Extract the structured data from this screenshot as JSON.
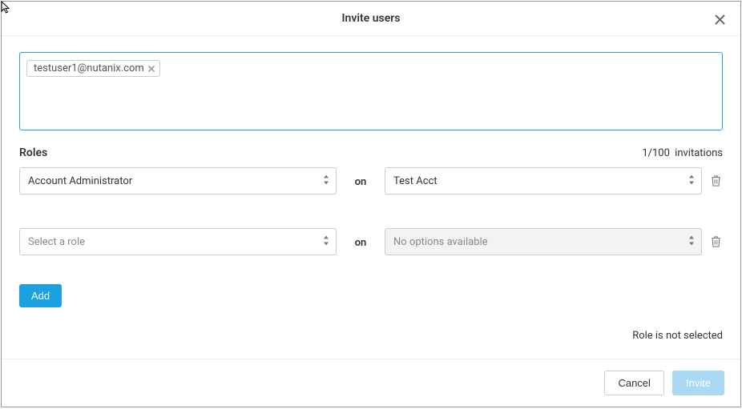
{
  "header": {
    "title": "Invite users"
  },
  "emails": {
    "chips": [
      "testuser1@nutanix.com"
    ]
  },
  "invitations_label_prefix": "1/100",
  "invitations_label_suffix": "invitations",
  "roles_label": "Roles",
  "roles": {
    "rows": [
      {
        "role": "Account Administrator",
        "on": "on",
        "scope": "Test Acct",
        "placeholder": false,
        "disabled": false
      },
      {
        "role": "Select a role",
        "on": "on",
        "scope": "No options available",
        "placeholder": true,
        "disabled": true
      }
    ]
  },
  "buttons": {
    "add": "Add",
    "cancel": "Cancel",
    "invite": "Invite"
  },
  "error": "Role is not selected"
}
